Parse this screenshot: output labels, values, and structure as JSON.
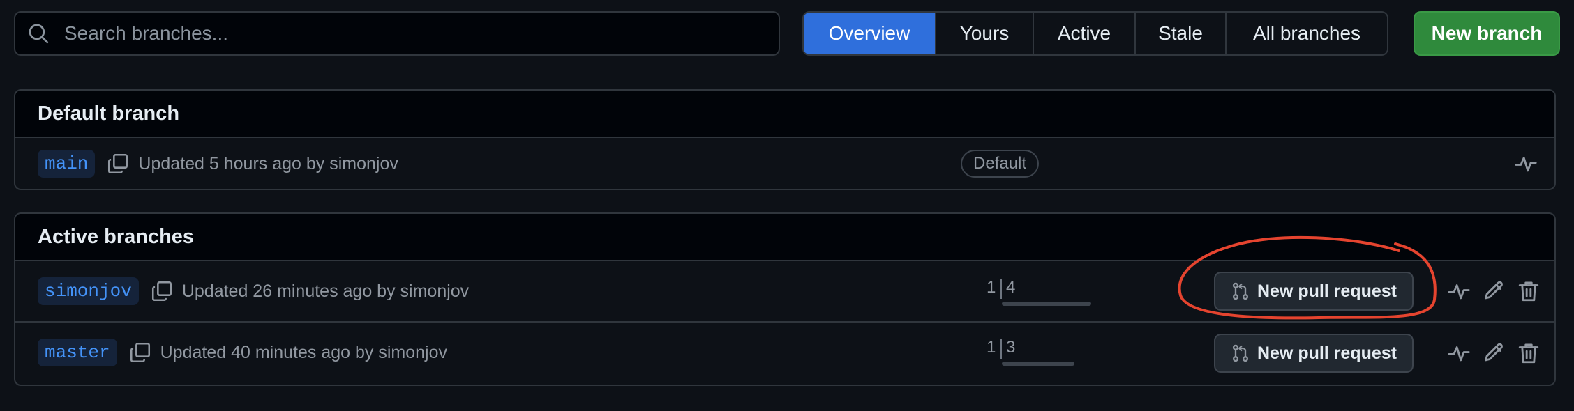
{
  "search": {
    "placeholder": "Search branches..."
  },
  "tabs": [
    {
      "label": "Overview",
      "active": true
    },
    {
      "label": "Yours",
      "active": false
    },
    {
      "label": "Active",
      "active": false
    },
    {
      "label": "Stale",
      "active": false
    },
    {
      "label": "All branches",
      "active": false
    }
  ],
  "new_branch_label": "New branch",
  "default_section": {
    "title": "Default branch",
    "branch": {
      "name": "main",
      "updated": "Updated 5 hours ago by simonjov",
      "badge": "Default"
    }
  },
  "active_section": {
    "title": "Active branches",
    "branches": [
      {
        "name": "simonjov",
        "updated": "Updated 26 minutes ago by simonjov",
        "behind": "1",
        "ahead": "4",
        "pr_label": "New pull request"
      },
      {
        "name": "master",
        "updated": "Updated 40 minutes ago by simonjov",
        "behind": "1",
        "ahead": "3",
        "pr_label": "New pull request"
      }
    ]
  },
  "icons": {
    "search": "search-icon",
    "copy": "copy-icon",
    "activity": "pulse-icon",
    "pull_request": "git-pull-request-icon",
    "edit": "pencil-icon",
    "delete": "trash-icon"
  },
  "colors": {
    "background": "#0d1117",
    "accent_blue": "#2f6fdc",
    "new_branch_green": "#2f8a3c",
    "link_blue": "#4493f8",
    "annotation_red": "#e5442f"
  }
}
